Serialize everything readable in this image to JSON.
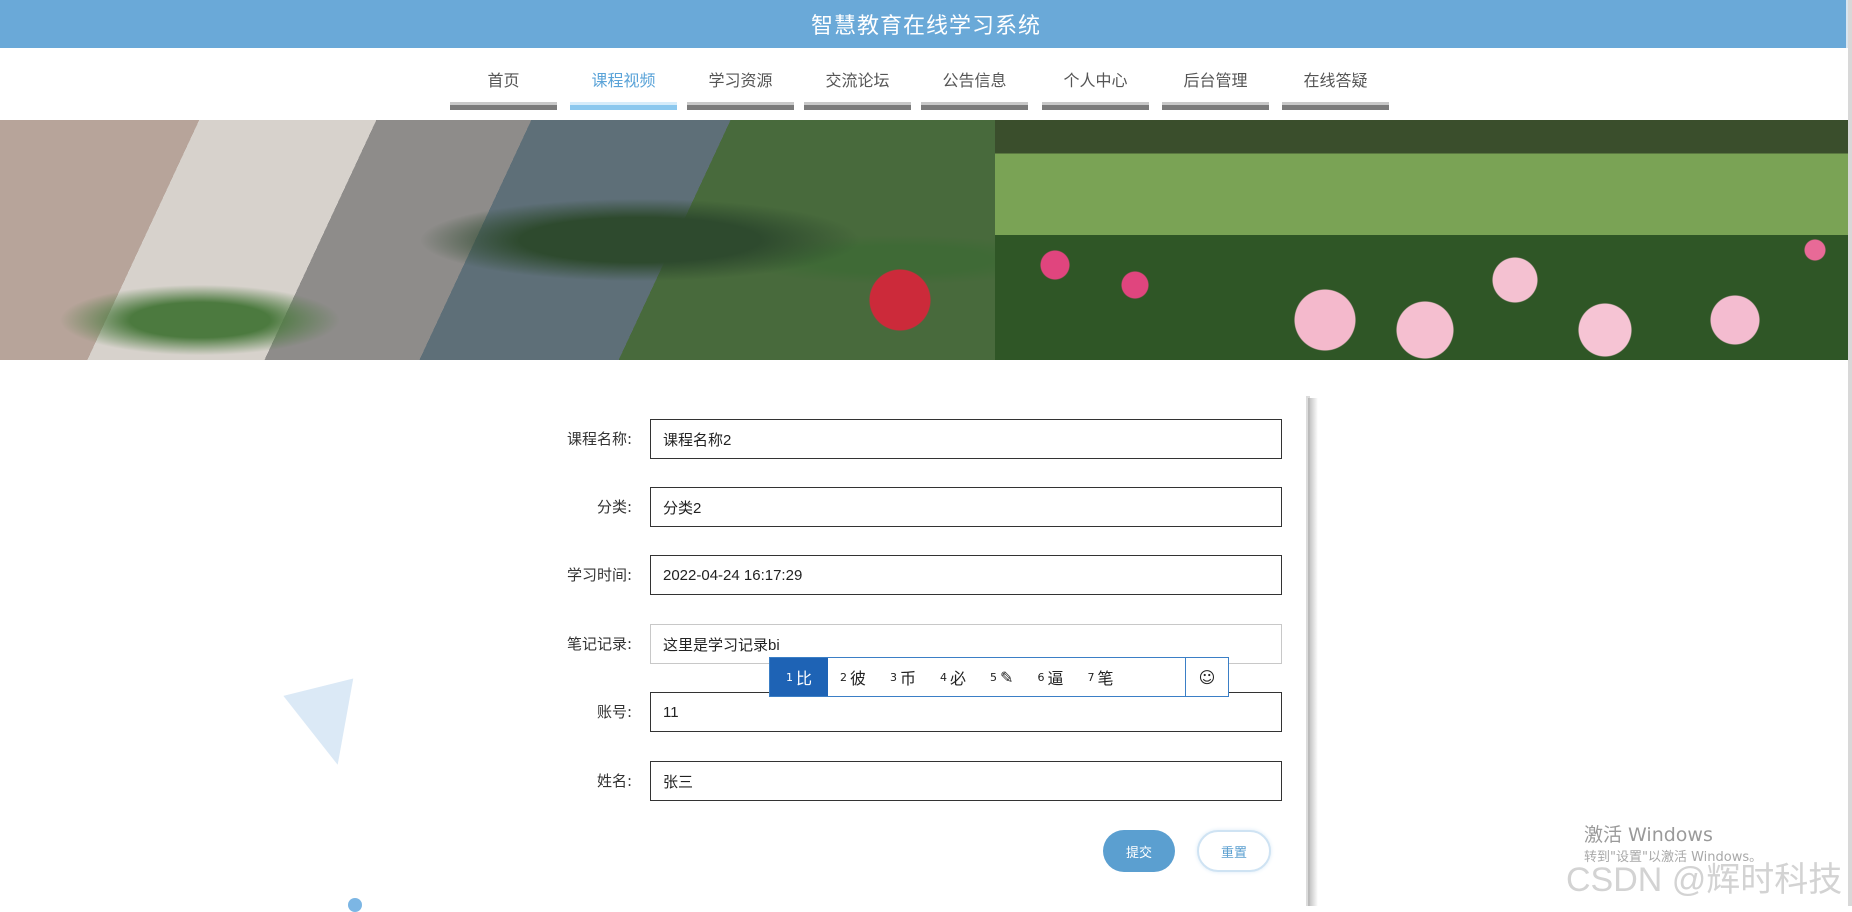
{
  "header": {
    "title": "智慧教育在线学习系统"
  },
  "nav": {
    "items": [
      {
        "label": "首页",
        "active": false
      },
      {
        "label": "课程视频",
        "active": true
      },
      {
        "label": "学习资源",
        "active": false
      },
      {
        "label": "交流论坛",
        "active": false
      },
      {
        "label": "公告信息",
        "active": false
      },
      {
        "label": "个人中心",
        "active": false
      },
      {
        "label": "后台管理",
        "active": false
      },
      {
        "label": "在线答疑",
        "active": false
      }
    ]
  },
  "form": {
    "course_name": {
      "label": "课程名称:",
      "value": "课程名称2"
    },
    "category": {
      "label": "分类:",
      "value": "分类2"
    },
    "study_time": {
      "label": "学习时间:",
      "value": "2022-04-24 16:17:29"
    },
    "notes": {
      "label": "笔记记录:",
      "value": "这里是学习记录bi"
    },
    "account": {
      "label": "账号:",
      "value": "11"
    },
    "name": {
      "label": "姓名:",
      "value": "张三"
    },
    "submit_label": "提交",
    "reset_label": "重置"
  },
  "ime": {
    "candidates": [
      {
        "num": "1",
        "text": "比"
      },
      {
        "num": "2",
        "text": "彼"
      },
      {
        "num": "3",
        "text": "币"
      },
      {
        "num": "4",
        "text": "必"
      },
      {
        "num": "5",
        "text": "✎"
      },
      {
        "num": "6",
        "text": "逼"
      },
      {
        "num": "7",
        "text": "笔"
      }
    ],
    "emoji": "☺"
  },
  "watermark": {
    "activate_title": "激活 Windows",
    "activate_sub": "转到\"设置\"以激活 Windows。",
    "csdn": "CSDN @辉时科技"
  },
  "colors": {
    "header": "#6aa9d8",
    "accent": "#5b9fd0",
    "ime_selected": "#1e63b5"
  }
}
